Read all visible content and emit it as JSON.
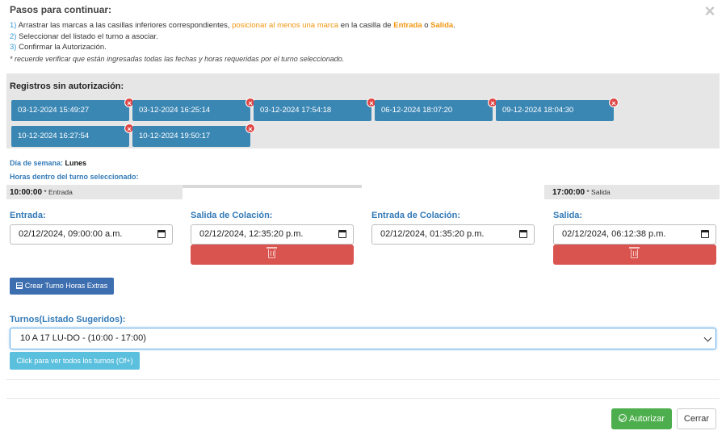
{
  "header": {
    "title": "Pasos para continuar:",
    "close_icon": "×",
    "step1_num": "1)",
    "step1_text": " Arrastrar las marcas a las casillas inferiores correspondientes, ",
    "step1_highlight": "posicionar al menos una marca",
    "step1_mid": " en la casilla de ",
    "step1_entrada": "Entrada",
    "step1_o": " o ",
    "step1_salida": "Salida",
    "step1_end": ".",
    "step2_num": "2)",
    "step2_text": " Seleccionar del listado el turno a asociar.",
    "step3_num": "3)",
    "step3_text": " Confirmar la Autorización.",
    "note": "* recuerde verificar que están ingresadas todas las fechas y horas requeridas por el turno seleccionado."
  },
  "registros": {
    "title": "Registros sin autorización:",
    "remove_icon": "×",
    "items": [
      "03-12-2024 15:49:27",
      "03-12-2024 16:25:14",
      "03-12-2024 17:54:18",
      "06-12-2024 18:07:20",
      "09-12-2024 18:04:30",
      "10-12-2024 16:27:54",
      "10-12-2024 19:50:17"
    ]
  },
  "turno": {
    "dia_label": "Día de semana:",
    "dia_value": "Lunes",
    "horas_label": "Horas dentro del turno seleccionado:",
    "entrada_time": "10:00:00",
    "entrada_sub": " * Entrada",
    "salida_time": "17:00:00",
    "salida_sub": " * Salida"
  },
  "fields": {
    "entrada_label": "Entrada:",
    "entrada_value": "02/12/2024, 09:00:00 a.m.",
    "salida_colacion_label": "Salida de Colación:",
    "salida_colacion_value": "02/12/2024, 12:35:20 p.m.",
    "entrada_colacion_label": "Entrada de Colación:",
    "entrada_colacion_value": "02/12/2024, 01:35:20 p.m.",
    "salida_label": "Salida:",
    "salida_value": "02/12/2024, 06:12:38 p.m."
  },
  "buttons": {
    "crear_turno": "Crear Turno Horas Extras",
    "ver_todos": "Click para ver todos los turnos (Of+)",
    "autorizar": "Autorizar",
    "cerrar": "Cerrar"
  },
  "select": {
    "label": "Turnos(Listado Sugeridos):",
    "value": "10 A 17 LU-DO - (10:00 - 17:00)"
  },
  "colors": {
    "accent_blue": "#337ab7",
    "chip_blue": "#3b87b4",
    "danger": "#d9534f",
    "success": "#4cae4c",
    "info": "#5bc0de",
    "warning_text": "#f0960e"
  }
}
